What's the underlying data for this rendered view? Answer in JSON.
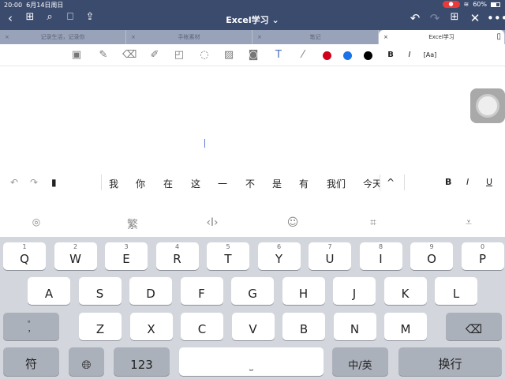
{
  "status": {
    "time": "20:00",
    "date": "6月14日周日",
    "battery": "60%"
  },
  "header": {
    "title": "Excel学习 ⌄"
  },
  "tabs": [
    {
      "label": "记录生活，记录你"
    },
    {
      "label": "手帐素材"
    },
    {
      "label": "笔记"
    },
    {
      "label": "Excel学习",
      "active": true
    }
  ],
  "toolbar": {
    "bold": "B",
    "italic": "I",
    "text_style": "[Aa]",
    "colors": [
      "#d0021b",
      "#1a73e8",
      "#000000"
    ]
  },
  "candidates": [
    "我",
    "你",
    "在",
    "这",
    "一",
    "不",
    "是",
    "有",
    "我们",
    "今天"
  ],
  "format": {
    "bold": "B",
    "italic": "I",
    "underline": "U"
  },
  "fnrow": {
    "traditional": "繁"
  },
  "keyboard": {
    "row1": [
      {
        "k": "Q",
        "n": "1"
      },
      {
        "k": "W",
        "n": "2"
      },
      {
        "k": "E",
        "n": "3"
      },
      {
        "k": "R",
        "n": "4"
      },
      {
        "k": "T",
        "n": "5"
      },
      {
        "k": "Y",
        "n": "6"
      },
      {
        "k": "U",
        "n": "7"
      },
      {
        "k": "I",
        "n": "8"
      },
      {
        "k": "O",
        "n": "9"
      },
      {
        "k": "P",
        "n": "0"
      }
    ],
    "row2": [
      "A",
      "S",
      "D",
      "F",
      "G",
      "H",
      "J",
      "K",
      "L"
    ],
    "row3": [
      "Z",
      "X",
      "C",
      "V",
      "B",
      "N",
      "M"
    ],
    "punct": "。\n，",
    "symbols": "符",
    "numbers": "123",
    "lang": "中/英",
    "enter": "换行"
  }
}
